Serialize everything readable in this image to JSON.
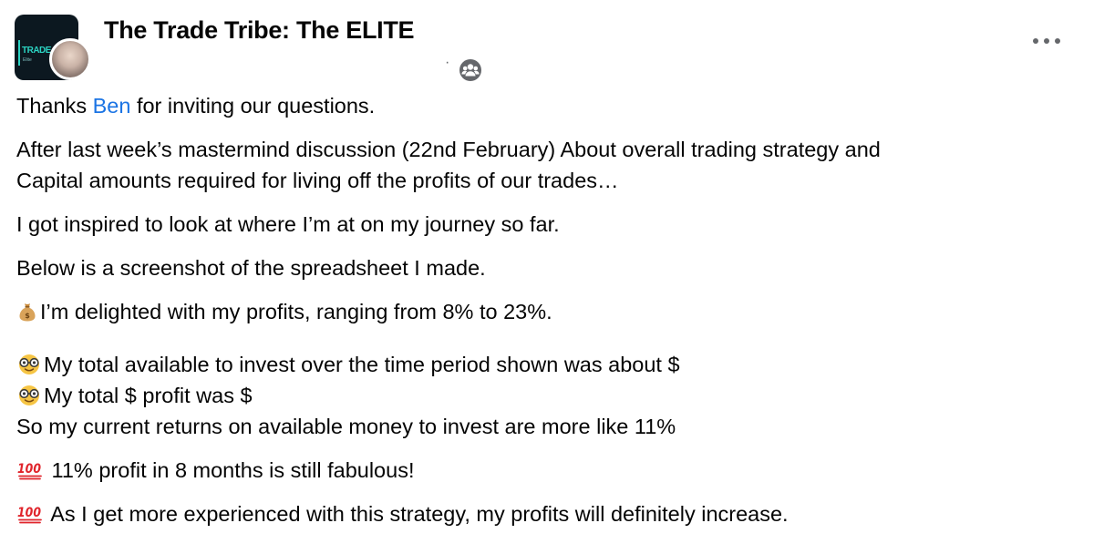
{
  "post": {
    "group_name": "The Trade Tribe: The ELITE",
    "avatar_text": "TRADE",
    "avatar_subtext": "Elite",
    "separator": "·",
    "icons": {
      "audience": "private-group-icon",
      "more": "more-options-icon",
      "money_bag": "money-bag-emoji",
      "nerd": "nerd-face-emoji",
      "hundred": "hundred-points-emoji"
    },
    "colors": {
      "mention": "#1b74e4",
      "text": "#050505",
      "meta": "#65676b"
    },
    "body": {
      "p1_pre": "Thanks ",
      "p1_mention": "Ben",
      "p1_post": " for inviting our questions.",
      "p2_line1": "After last week’s mastermind discussion (22nd February) About overall trading strategy and",
      "p2_line2": "Capital amounts required for living off the profits of our trades…",
      "p3": "I got inspired to look at where I’m at on my journey so far.",
      "p4": "Below is a screenshot of the spreadsheet I made.",
      "p5": "I’m delighted with my profits, ranging from 8% to 23%.",
      "p6_line1": "My total available to invest over the time period shown was about $",
      "p6_line2": "My total $ profit was $",
      "p6_line3": "So my current returns on available money to invest are more like 11%",
      "p7": " 11% profit in 8 months is still fabulous!",
      "p8": " As I get more experienced with this strategy, my profits will definitely increase."
    }
  }
}
